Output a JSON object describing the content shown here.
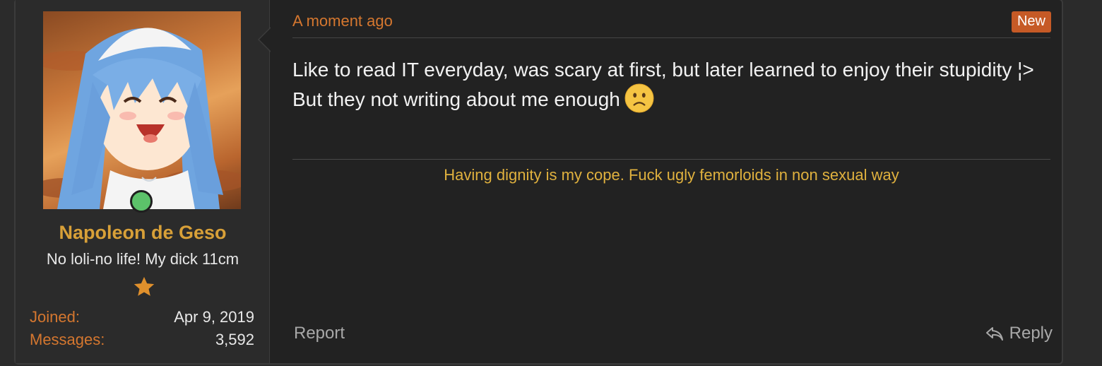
{
  "user": {
    "name": "Napoleon de Geso",
    "title": "No loli-no life! My dick 11cm",
    "avatar_icon": "anime-girl-avatar",
    "online_status": "online",
    "rank_icon": "star-icon",
    "stats": [
      {
        "label": "Joined:",
        "value": "Apr 9, 2019"
      },
      {
        "label": "Messages:",
        "value": "3,592"
      }
    ]
  },
  "post": {
    "time": "A moment ago",
    "badge": "New",
    "body_line1": "Like to read IT everyday, was scary at first, but later learned to enjoy their stupidity ¦>",
    "body_line2": "But they not writing about me enough",
    "emoji_icon": "frowning-face-emoji-icon",
    "signature": "Having dignity is my cope. Fuck ugly femorloids in non sexual way"
  },
  "actions": {
    "report_label": "Report",
    "reply_label": "Reply",
    "reply_icon": "reply-arrow-icon"
  },
  "colors": {
    "accent_orange": "#d5772f",
    "username_gold": "#d8a038",
    "signature_yellow": "#e0b13e",
    "badge_bg": "#c65a26",
    "online_green": "#5cc26a"
  }
}
